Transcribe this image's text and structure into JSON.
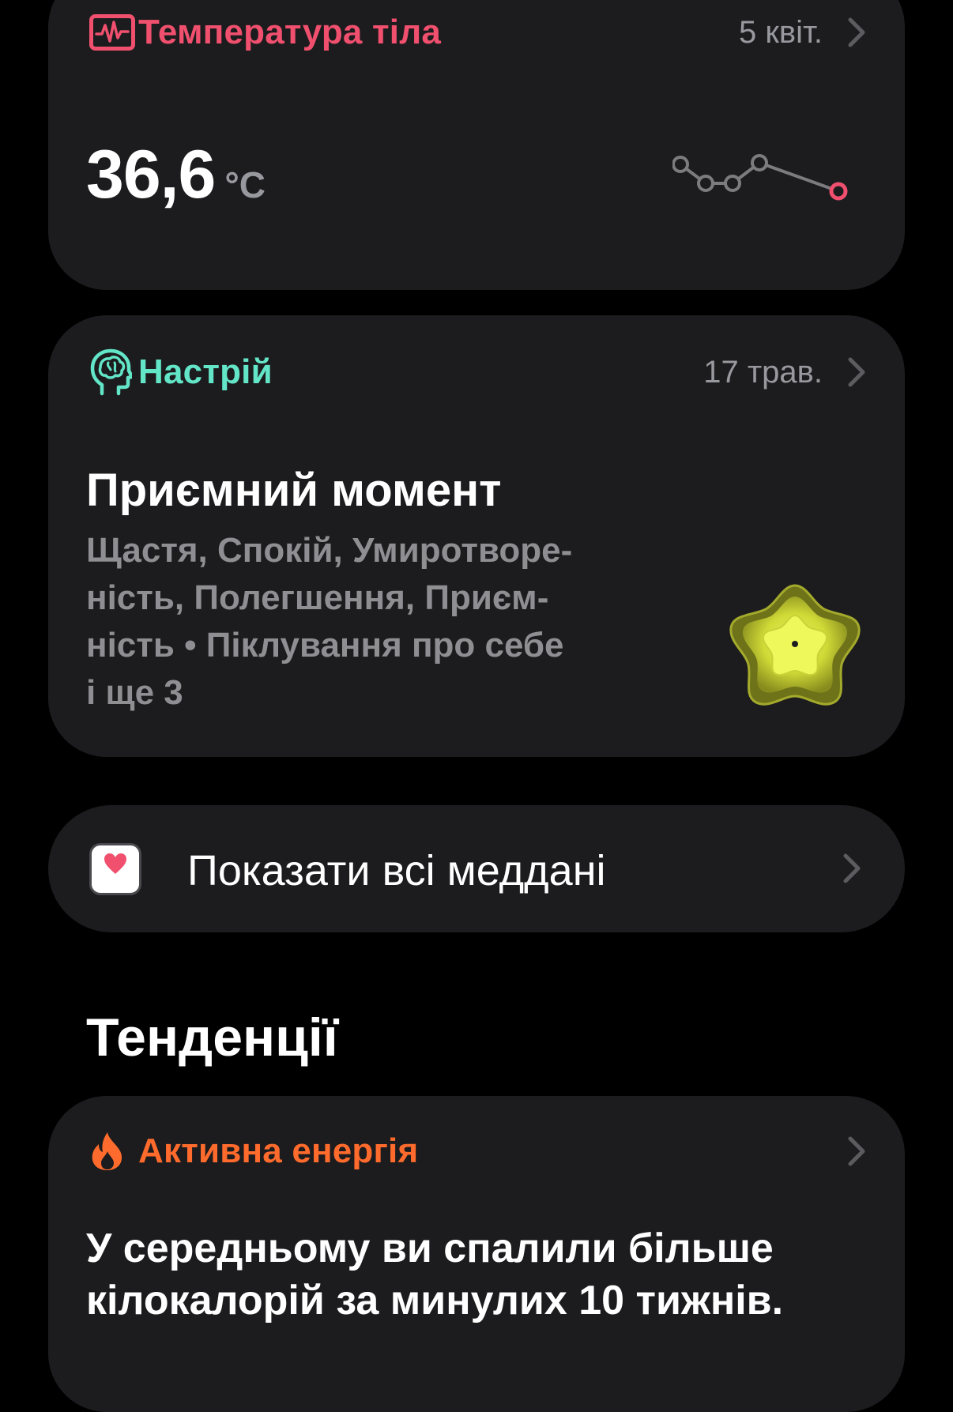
{
  "colors": {
    "background": "#000000",
    "card": "#1c1c1e",
    "temperature_accent": "#f0506e",
    "mood_accent": "#63e6c8",
    "energy_accent": "#ff6b2c",
    "secondary_text": "#98989f",
    "chevron": "#5b5b60"
  },
  "temperature": {
    "title": "Температура тіла",
    "icon": "waveform-monitor-icon",
    "date": "5 квіт.",
    "value": "36,6",
    "unit": "°C"
  },
  "mood": {
    "title": "Настрій",
    "icon": "head-brain-icon",
    "date": "17 трав.",
    "state": "Приємний момент",
    "description_lines": [
      "Щастя, Спокій, Умиротворе-",
      "ність, Полегшення, Приєм-",
      "ність • Піклування про себе",
      "і ще 3"
    ],
    "graphic": "yellow-star-flower-icon"
  },
  "all_data": {
    "icon": "health-app-heart-icon",
    "label": "Показати всі меддані"
  },
  "trends": {
    "section_title": "Тенденції",
    "card": {
      "title": "Активна енергія",
      "icon": "flame-icon",
      "text_lines": [
        "У середньому ви спалили більше",
        "кілокалорій за минулих 10 тижнів."
      ]
    }
  }
}
